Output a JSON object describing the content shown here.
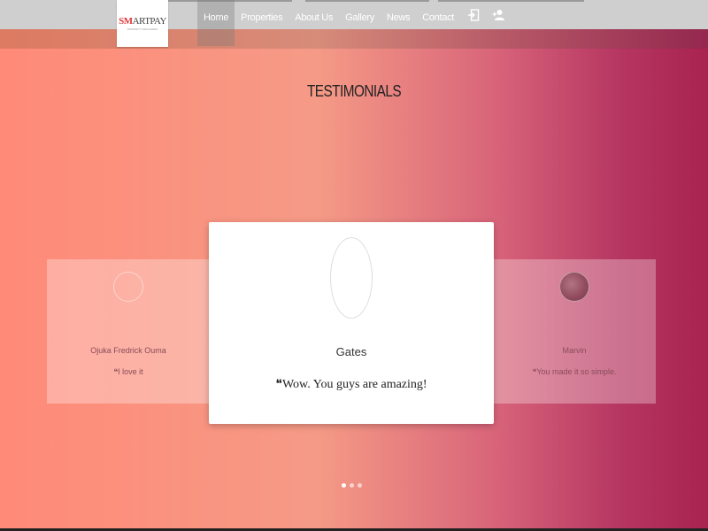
{
  "logo": {
    "brand_s": "S",
    "brand_m": "M",
    "brand_rest": "ARTPAY",
    "tagline": "PROPERTY MANAGERS"
  },
  "nav": {
    "items": [
      {
        "label": "Home",
        "active": true
      },
      {
        "label": "Properties"
      },
      {
        "label": "About Us"
      },
      {
        "label": "Gallery"
      },
      {
        "label": "News"
      },
      {
        "label": "Contact"
      }
    ],
    "icons": [
      "login-icon",
      "add-user-icon"
    ]
  },
  "section": {
    "title": "TESTIMONIALS"
  },
  "testimonials": [
    {
      "name": "Ojuka Fredrick Ouma",
      "quote": "I love it"
    },
    {
      "name": "Gates",
      "quote": "Wow. You guys are amazing!"
    },
    {
      "name": "Marvin",
      "quote": "You made it so simple."
    }
  ],
  "carousel": {
    "count": 3,
    "active_index": 0
  }
}
